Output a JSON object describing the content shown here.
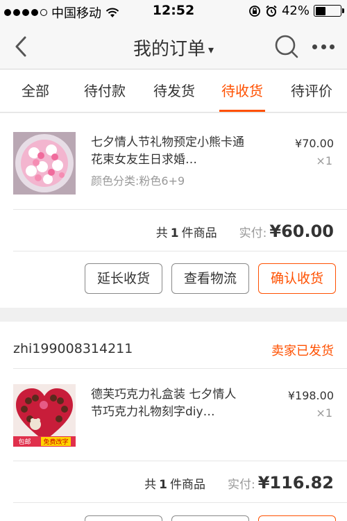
{
  "status_bar": {
    "carrier": "中国移动",
    "time": "12:52",
    "battery": "42%",
    "battery_level": 0.42
  },
  "nav": {
    "title": "我的订单",
    "caret": "▾"
  },
  "tabs": [
    {
      "label": "全部",
      "active": false
    },
    {
      "label": "待付款",
      "active": false
    },
    {
      "label": "待发货",
      "active": false
    },
    {
      "label": "待收货",
      "active": true
    },
    {
      "label": "待评价",
      "active": false
    }
  ],
  "orders": [
    {
      "item": {
        "title": "七夕情人节礼物预定小熊卡通花束女友生日求婚…",
        "spec": "颜色分类:粉色6+9",
        "price": "¥70.00",
        "qty": "×1"
      },
      "summary": {
        "prefix": "共",
        "count": "1",
        "suffix": "件商品",
        "paid_label": "实付:",
        "paid_amount": "¥60.00"
      },
      "buttons": {
        "extend": "延长收货",
        "logistics": "查看物流",
        "confirm": "确认收货"
      }
    },
    {
      "shop": "zhi199008314211",
      "status": "卖家已发货",
      "item": {
        "title": "德芙巧克力礼盒装 七夕情人节巧克力礼物刻字diy…",
        "price": "¥198.00",
        "qty": "×1"
      },
      "thumb_badges": {
        "ship": "包邮",
        "engrave": "免费改字"
      },
      "summary": {
        "prefix": "共",
        "count": "1",
        "suffix": "件商品",
        "paid_label": "实付:",
        "paid_amount": "¥116.82"
      }
    }
  ],
  "colors": {
    "accent": "#ff5000",
    "background": "#f0f0f0"
  }
}
